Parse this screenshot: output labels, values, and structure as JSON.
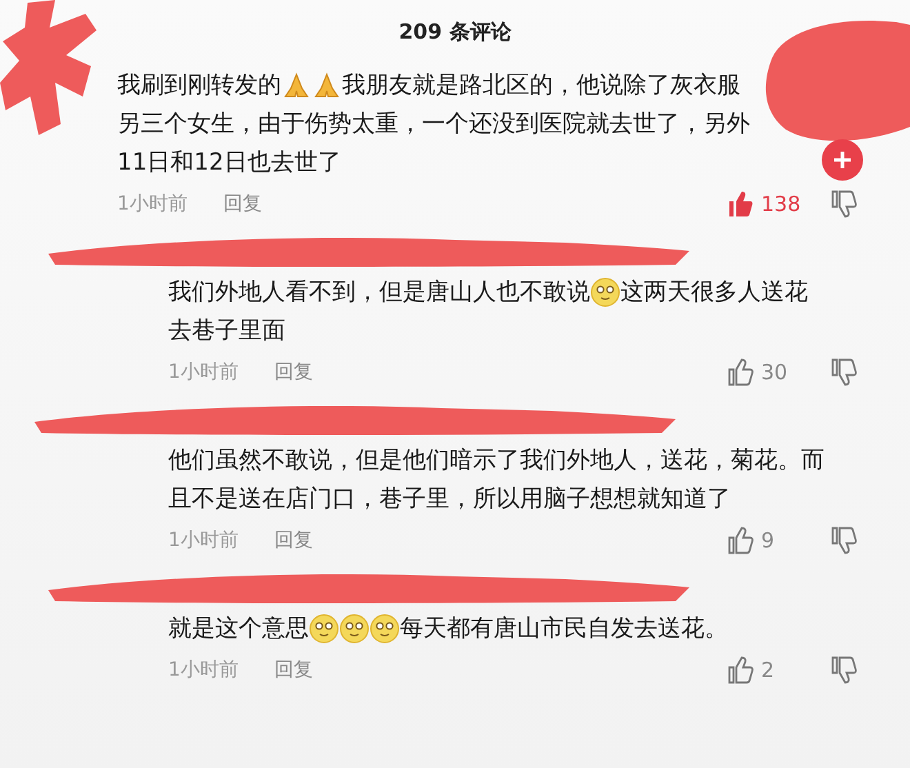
{
  "header": {
    "title": "209 条评论"
  },
  "comments": [
    {
      "kind": "top",
      "lines": [
        [
          {
            "kind": "text",
            "text": "我刷到刚转发的"
          },
          {
            "kind": "pray-emoji"
          },
          {
            "kind": "pray-emoji"
          },
          {
            "kind": "text",
            "text": "我朋友就是路北区的，他说除了灰衣服"
          }
        ],
        [
          {
            "kind": "text",
            "text": "另三个女生，由于伤势太重，一个还没到医院就去世了，另外"
          }
        ],
        [
          {
            "kind": "text",
            "text": "11日和12日也去世了"
          }
        ]
      ],
      "time": "1小时前",
      "reply": "回复",
      "likes": "138",
      "liked": true
    },
    {
      "kind": "reply",
      "lines": [
        [
          {
            "kind": "text",
            "text": "我们外地人看不到，但是唐山人也不敢说"
          },
          {
            "kind": "face-emoji"
          },
          {
            "kind": "text",
            "text": "这两天很多人送花"
          }
        ],
        [
          {
            "kind": "text",
            "text": "去巷子里面"
          }
        ]
      ],
      "time": "1小时前",
      "reply": "回复",
      "likes": "30",
      "liked": false
    },
    {
      "kind": "reply",
      "lines": [
        [
          {
            "kind": "text",
            "text": "他们虽然不敢说，但是他们暗示了我们外地人，送花，菊花。而"
          }
        ],
        [
          {
            "kind": "text",
            "text": "且不是送在店门口，巷子里，所以用脑子想想就知道了"
          }
        ]
      ],
      "time": "1小时前",
      "reply": "回复",
      "likes": "9",
      "liked": false
    },
    {
      "kind": "reply",
      "lines": [
        [
          {
            "kind": "text",
            "text": "就是这个意思"
          },
          {
            "kind": "face-emoji"
          },
          {
            "kind": "face-emoji"
          },
          {
            "kind": "face-emoji"
          },
          {
            "kind": "text",
            "text": "每天都有唐山市民自发去送花。"
          }
        ]
      ],
      "time": "1小时前",
      "reply": "回复",
      "likes": "2",
      "liked": false
    }
  ]
}
